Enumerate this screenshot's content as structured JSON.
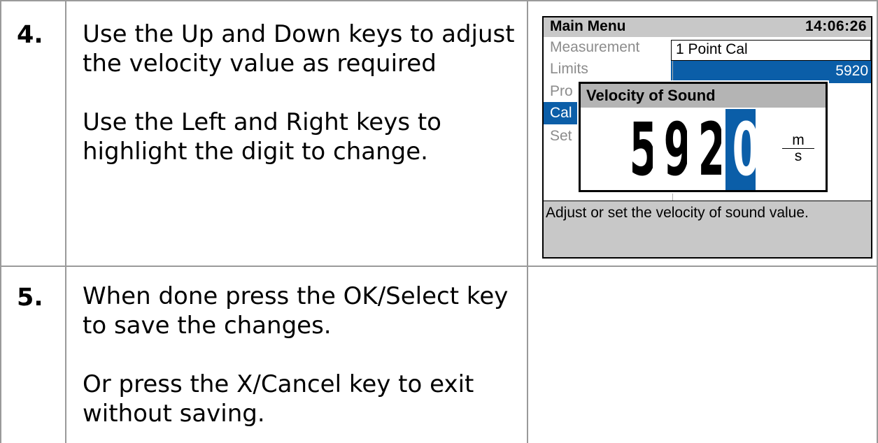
{
  "steps": [
    {
      "number": "4.",
      "paragraphs": [
        "Use the Up and Down keys to adjust the velocity value as required",
        "Use the Left and Right keys to highlight the digit to change."
      ]
    },
    {
      "number": "5.",
      "paragraphs": [
        "When done press the OK/Select key to save the changes.",
        "Or press the X/Cancel key to exit without saving."
      ]
    }
  ],
  "device": {
    "title": "Main Menu",
    "time": "14:06:26",
    "menu_items": [
      "Measurement",
      "Limits",
      "Pro",
      "Cal",
      "Set"
    ],
    "active_menu_index": 3,
    "submenu_item": "1 Point Cal",
    "submenu_selected_value": "5920",
    "help_text": "Adjust or set the velocity of sound value.",
    "popup": {
      "title": "Velocity of Sound",
      "digits": [
        "5",
        "9",
        "2",
        "0"
      ],
      "selected_digit_index": 3,
      "unit_numerator": "m",
      "unit_denominator": "s"
    },
    "colors": {
      "highlight": "#0b5ea8",
      "title_bar": "#c8c8c8",
      "popup_title_bar": "#b4b4b4",
      "inactive_text": "#8c8c8c"
    }
  }
}
